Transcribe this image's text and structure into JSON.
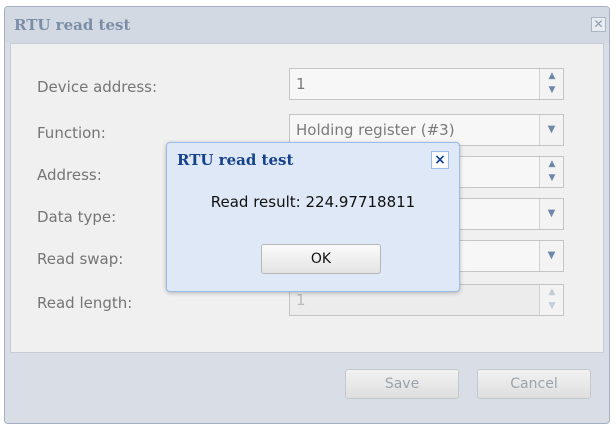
{
  "window": {
    "title": "RTU read test",
    "close_icon": "close-icon"
  },
  "form": {
    "rows": [
      {
        "label": "Device address:",
        "value": "1",
        "control": "spinner",
        "enabled": true
      },
      {
        "label": "Function:",
        "value": "Holding register (#3)",
        "control": "dropdown",
        "enabled": true
      },
      {
        "label": "Address:",
        "value": "",
        "control": "spinner",
        "enabled": true
      },
      {
        "label": "Data type:",
        "value": "",
        "control": "dropdown",
        "enabled": true
      },
      {
        "label": "Read swap:",
        "value": "",
        "control": "dropdown",
        "enabled": true
      },
      {
        "label": "Read length:",
        "value": "1",
        "control": "spinner",
        "enabled": false
      }
    ]
  },
  "footer": {
    "save_label": "Save",
    "cancel_label": "Cancel"
  },
  "modal": {
    "title": "RTU read test",
    "message": "Read result: 224.97718811",
    "ok_label": "OK",
    "close_icon": "close-icon"
  },
  "colors": {
    "modal_title": "#15428b",
    "modal_background": "#dfe8f6",
    "modal_border": "#99bce8",
    "window_background": "#d9dee6"
  }
}
